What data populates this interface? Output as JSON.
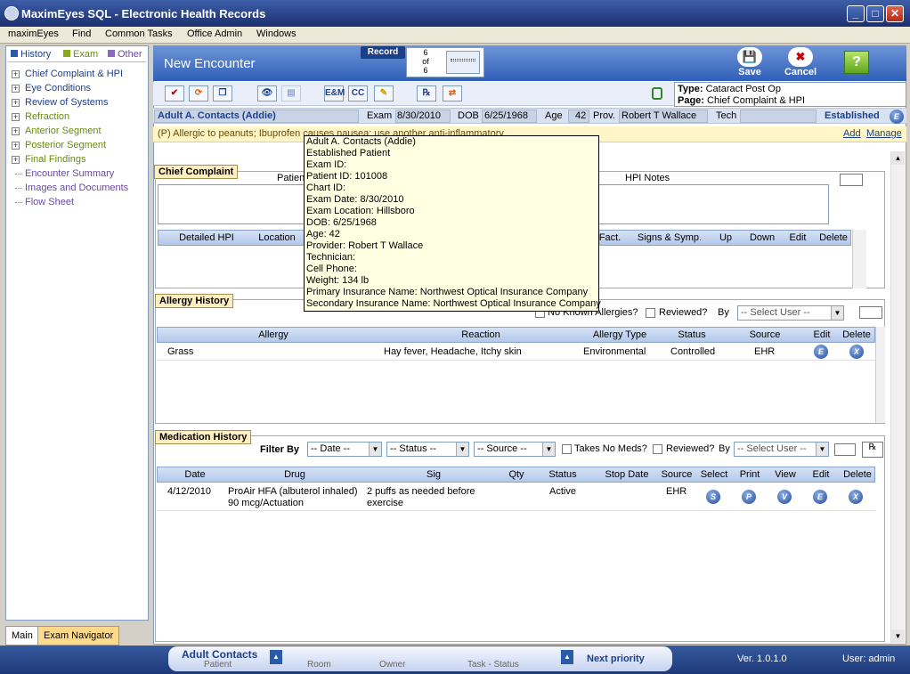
{
  "window": {
    "title": "MaximEyes SQL - Electronic Health Records"
  },
  "menu": [
    "maximEyes",
    "Find",
    "Common Tasks",
    "Office Admin",
    "Windows"
  ],
  "legend": [
    "History",
    "Exam",
    "Other"
  ],
  "tree": [
    {
      "label": "Chief Complaint & HPI",
      "exp": true,
      "color": "#1c3f8a"
    },
    {
      "label": "Eye Conditions",
      "exp": true,
      "color": "#1c3f8a"
    },
    {
      "label": "Review of Systems",
      "exp": true,
      "color": "#1c3f8a"
    },
    {
      "label": "Refraction",
      "exp": true,
      "color": "#6b8a10"
    },
    {
      "label": "Anterior Segment",
      "exp": true,
      "color": "#6b8a10"
    },
    {
      "label": "Posterior Segment",
      "exp": true,
      "color": "#6b8a10"
    },
    {
      "label": "Final Findings",
      "exp": true,
      "color": "#6b8a10"
    },
    {
      "label": "Encounter Summary",
      "exp": false,
      "color": "#6a4aa0"
    },
    {
      "label": "Images and Documents",
      "exp": false,
      "color": "#6a4aa0"
    },
    {
      "label": "Flow Sheet",
      "exp": false,
      "color": "#6a4aa0"
    }
  ],
  "left_tabs": [
    "Main",
    "Exam Navigator"
  ],
  "header": {
    "title": "New Encounter",
    "record_label": "Record",
    "rec_current": "6",
    "rec_of": "of",
    "rec_total": "6",
    "save": "Save",
    "cancel": "Cancel",
    "help": "?"
  },
  "type_box": {
    "type_label": "Type:",
    "type_value": "Cataract Post Op",
    "page_label": "Page:",
    "page_value": "Chief Complaint & HPI"
  },
  "toolbar": {
    "em": "E&M",
    "cc": "CC"
  },
  "patient": {
    "name": "Adult A. Contacts (Addie)",
    "exam_label": "Exam",
    "exam": "8/30/2010",
    "dob_label": "DOB",
    "dob": "6/25/1968",
    "age_label": "Age",
    "age": "42",
    "prov_label": "Prov.",
    "prov": "Robert T Wallace",
    "tech_label": "Tech",
    "status": "Established",
    "status_icon": "E"
  },
  "allergy_bar": {
    "text": "(P) Allergic to peanuts; Ibuprofen causes nausea; use another anti-inflammatory",
    "add": "Add",
    "manage": "Manage"
  },
  "chief": {
    "title": "Chief Complaint",
    "patient_col": "Patient",
    "hpi_notes": "HPI Notes",
    "cols": [
      "Detailed HPI",
      "Location",
      "Fact.",
      "Signs & Symp.",
      "Up",
      "Down",
      "Edit",
      "Delete"
    ]
  },
  "allergy": {
    "title": "Allergy History",
    "no_known": "No Known Allergies?",
    "reviewed": "Reviewed?",
    "by": "By",
    "select_user": "-- Select User --",
    "cols": [
      "Allergy",
      "Reaction",
      "Allergy Type",
      "Status",
      "Source",
      "Edit",
      "Delete"
    ],
    "rows": [
      {
        "allergy": "Grass",
        "reaction": "Hay fever, Headache, Itchy skin",
        "type": "Environmental",
        "status": "Controlled",
        "source": "EHR",
        "edit": "E",
        "delete": "X"
      }
    ]
  },
  "meds": {
    "title": "Medication History",
    "filter_by": "Filter By",
    "date_dd": "-- Date --",
    "status_dd": "-- Status --",
    "source_dd": "-- Source --",
    "no_meds": "Takes No Meds?",
    "reviewed": "Reviewed?",
    "by": "By",
    "select_user": "-- Select User --",
    "cols": [
      "Date",
      "Drug",
      "Sig",
      "Qty",
      "Status",
      "Stop Date",
      "Source",
      "Select",
      "Print",
      "View",
      "Edit",
      "Delete"
    ],
    "rows": [
      {
        "date": "4/12/2010",
        "drug": "ProAir HFA (albuterol inhaled) 90 mcg/Actuation",
        "sig": "2 puffs as needed before exercise",
        "qty": "",
        "status": "Active",
        "stop": "",
        "source": "EHR",
        "select": "S",
        "print": "P",
        "view": "V",
        "edit": "E",
        "delete": "X"
      }
    ]
  },
  "tooltip": [
    "Adult A. Contacts (Addie)",
    "Established Patient",
    "Exam ID:",
    "Patient ID:  101008",
    "Chart ID:",
    "Exam Date:  8/30/2010",
    "Exam Location:  Hillsboro",
    "DOB:  6/25/1968",
    "Age:  42",
    "Provider:  Robert T Wallace",
    "Technician:",
    "Cell Phone:",
    "Weight:  134 lb",
    "Primary Insurance Name:  Northwest Optical Insurance Company",
    "Secondary Insurance Name:  Northwest Optical Insurance Company"
  ],
  "statusbar": {
    "patient_name": "Adult Contacts",
    "patient_label": "Patient",
    "room_label": "Room",
    "owner_label": "Owner",
    "task_label": "Task - Status",
    "next": "Next priority",
    "version": "Ver. 1.0.1.0",
    "user": "User: admin"
  }
}
